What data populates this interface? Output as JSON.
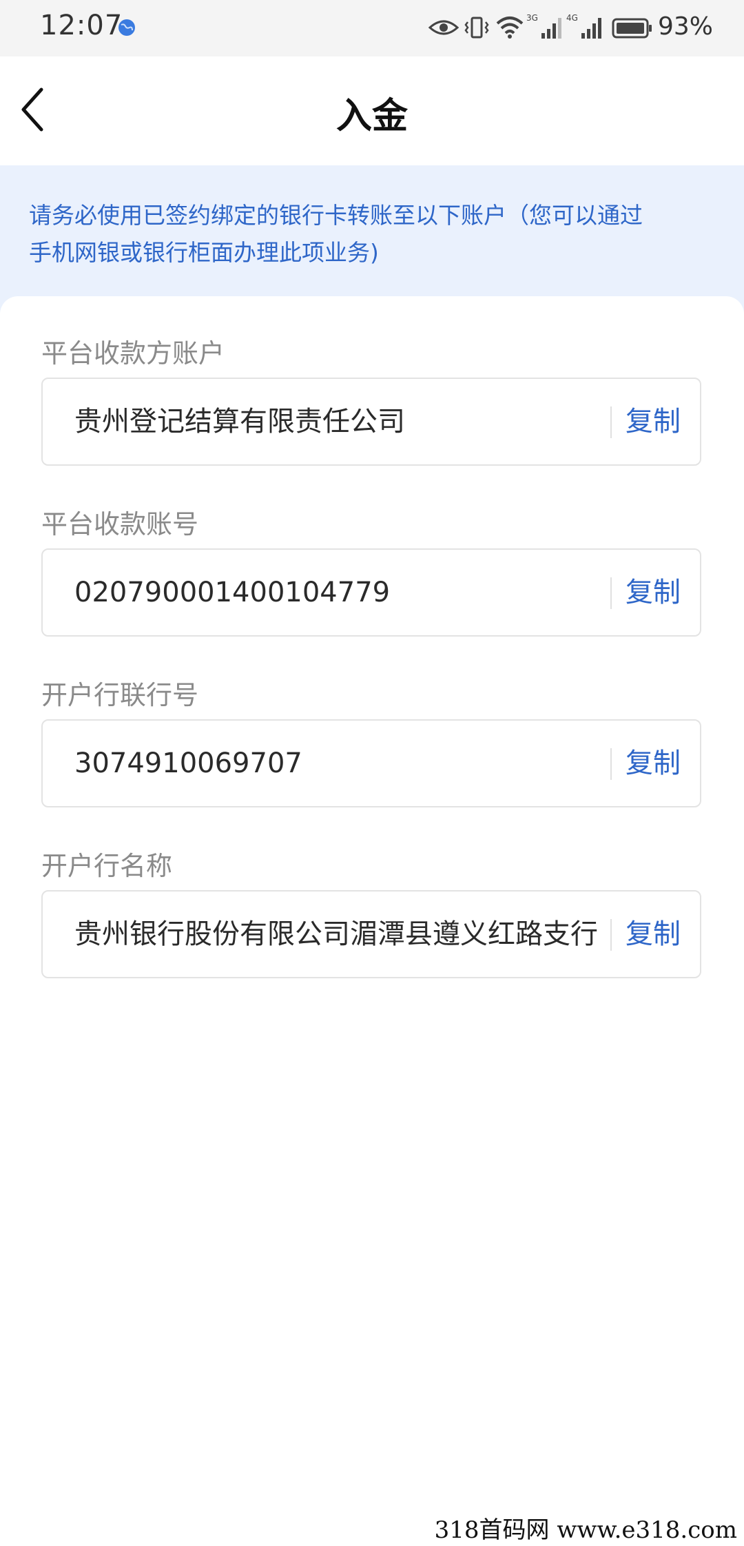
{
  "status_bar": {
    "time": "12:07",
    "battery": "93%",
    "signal_1_label": "3G",
    "signal_2_label": "4G"
  },
  "header": {
    "title": "入金"
  },
  "notice": {
    "line1": "请务必使用已签约绑定的银行卡转账至以下账户（您可以通过",
    "line2": "手机网银或银行柜面办理此项业务)"
  },
  "fields": [
    {
      "label": "平台收款方账户",
      "value": "贵州登记结算有限责任公司",
      "action": "复制"
    },
    {
      "label": "平台收款账号",
      "value": "020790001400104779",
      "action": "复制"
    },
    {
      "label": "开户行联行号",
      "value": "3074910069707",
      "action": "复制"
    },
    {
      "label": "开户行名称",
      "value": "贵州银行股份有限公司湄潭县遵义红路支行",
      "action": "复制"
    }
  ],
  "watermark": "318首码网  www.e318.com",
  "colors": {
    "accent": "#2e66c8",
    "notice_bg": "#eaf1fd",
    "label": "#8a8a8a"
  }
}
